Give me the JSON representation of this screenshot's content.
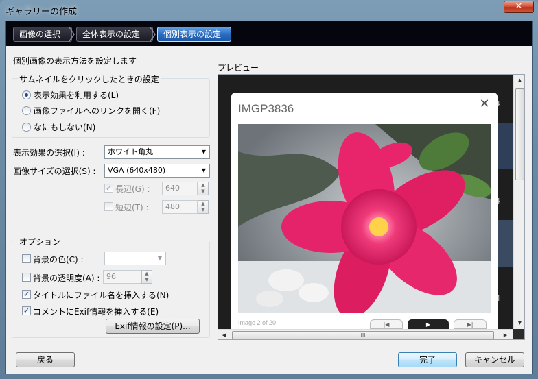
{
  "window": {
    "title": "ギャラリーの作成",
    "close_glyph": "✕"
  },
  "wizard": {
    "steps": [
      {
        "label": "画像の選択"
      },
      {
        "label": "全体表示の設定"
      },
      {
        "label": "個別表示の設定"
      }
    ]
  },
  "left": {
    "heading": "個別画像の表示方法を設定します",
    "click_group": {
      "title": "サムネイルをクリックしたときの設定",
      "options": [
        {
          "label": "表示効果を利用する(L)",
          "selected": true
        },
        {
          "label": "画像ファイルへのリンクを開く(F)",
          "selected": false
        },
        {
          "label": "なにもしない(N)",
          "selected": false
        }
      ]
    },
    "effect": {
      "label": "表示効果の選択(I) :",
      "value": "ホワイト角丸"
    },
    "size": {
      "label": "画像サイズの選択(S) :",
      "value": "VGA (640x480)"
    },
    "long_side": {
      "label": "長辺(G) :",
      "value": "640",
      "checked": true,
      "enabled": false
    },
    "short_side": {
      "label": "短辺(T) :",
      "value": "480",
      "checked": false,
      "enabled": false
    },
    "options_group": {
      "title": "オプション",
      "bg_color": {
        "label": "背景の色(C) :",
        "checked": false
      },
      "bg_opacity": {
        "label": "背景の透明度(A) :",
        "value": "96",
        "checked": false
      },
      "insert_title": {
        "label": "タイトルにファイル名を挿入する(N)",
        "checked": true
      },
      "insert_exif": {
        "label": "コメントにExif情報を挿入する(E)",
        "checked": true
      },
      "exif_button": "Exif情報の設定(P)..."
    }
  },
  "preview": {
    "label": "プレビュー",
    "image_title": "IMGP3836",
    "caption": "Image 2 of 20",
    "close_glyph": "✕",
    "thumb_digits": [
      "4",
      "4",
      "4"
    ]
  },
  "footer": {
    "back": "戻る",
    "finish": "完了",
    "cancel": "キャンセル"
  },
  "colors": {
    "wizard_bg": "#05050d",
    "active_step": "#2a6cc0",
    "preview_bg": "#1e1e1e",
    "flower": "#e8246a"
  }
}
